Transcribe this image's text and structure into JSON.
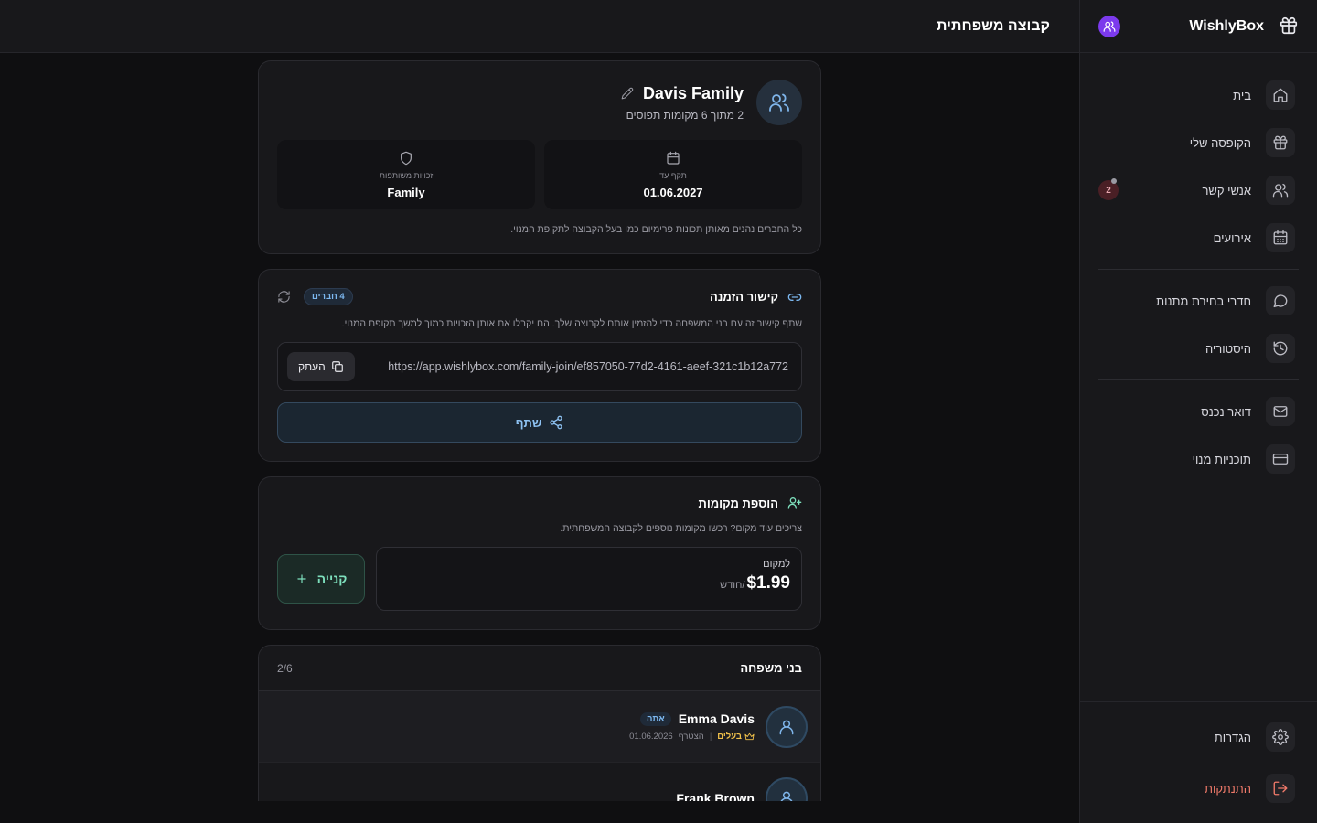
{
  "app": {
    "brand": "WishlyBox",
    "page_title": "קבוצה משפחתית"
  },
  "sidebar": {
    "items": [
      {
        "label": "בית",
        "icon": "home-icon"
      },
      {
        "label": "הקופסה שלי",
        "icon": "gift-icon"
      },
      {
        "label": "אנשי קשר",
        "icon": "users-icon",
        "badge": "2"
      },
      {
        "label": "אירועים",
        "icon": "calendar-icon"
      },
      {
        "label": "חדרי בחירת מתנות",
        "icon": "chat-icon"
      },
      {
        "label": "היסטוריה",
        "icon": "history-icon"
      },
      {
        "label": "דואר נכנס",
        "icon": "mail-icon"
      },
      {
        "label": "תוכניות מנוי",
        "icon": "credit-card-icon"
      }
    ],
    "bottom": [
      {
        "label": "הגדרות",
        "icon": "settings-icon"
      },
      {
        "label": "התנתקות",
        "icon": "logout-icon"
      }
    ]
  },
  "group": {
    "name": "Davis Family",
    "subtitle": "2 מתוך 6 מקומות תפוסים",
    "stats": [
      {
        "label": "תקף עד",
        "value": "01.06.2027",
        "icon": "calendar-icon"
      },
      {
        "label": "זכויות משותפות",
        "value": "Family",
        "icon": "shield-icon"
      }
    ],
    "note": "כל החברים נהנים מאותן תכונות פרימיום כמו בעל הקבוצה לתקופת המנוי."
  },
  "invite": {
    "title": "קישור הזמנה",
    "members_pill": "4 חברים",
    "description": "שתף קישור זה עם בני המשפחה כדי להזמין אותם לקבוצה שלך. הם יקבלו את אותן הזכויות כמוך למשך תקופת המנוי.",
    "link": "https://app.wishlybox.com/family-join/ef857050-77d2-4161-aeef-321c1b12a772",
    "copy_label": "העתק",
    "share_label": "שתף"
  },
  "seats": {
    "title": "הוספת מקומות",
    "description": "צריכים עוד מקום? רכשו מקומות נוספים לקבוצה המשפחתית.",
    "price_label": "למקום",
    "price": "$1.99",
    "price_unit": "/חודש",
    "buy_label": "קנייה"
  },
  "members": {
    "title": "בני משפחה",
    "count": "2/6",
    "list": [
      {
        "name": "Emma Davis",
        "you": "אתה",
        "role": "בעלים",
        "joined_label": "הצטרף",
        "joined": "01.06.2026"
      },
      {
        "name": "Frank Brown"
      }
    ]
  },
  "colors": {
    "accent_blue": "#7cb8f0",
    "accent_green": "#7ee0bd",
    "owner_gold": "#f0c04a",
    "logout_red": "#f07a6a"
  }
}
